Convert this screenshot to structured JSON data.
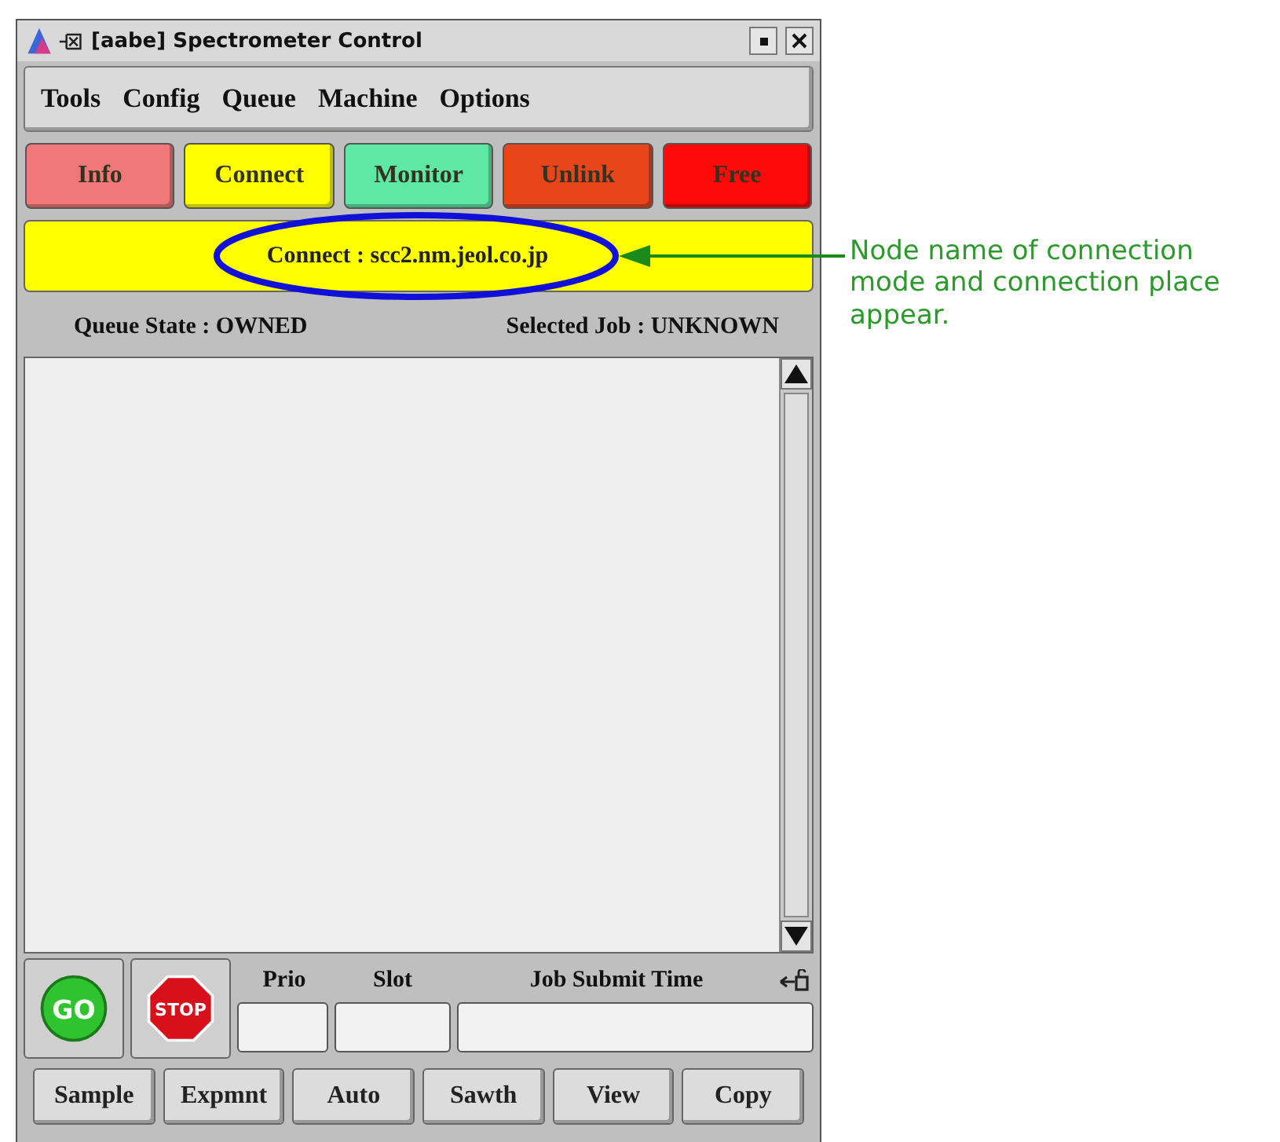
{
  "window": {
    "title": "[aabe] Spectrometer Control"
  },
  "menu": [
    "Tools",
    "Config",
    "Queue",
    "Machine",
    "Options"
  ],
  "mode_buttons": [
    {
      "label": "Info",
      "color": "#f07878"
    },
    {
      "label": "Connect",
      "color": "#ffff00"
    },
    {
      "label": "Monitor",
      "color": "#5ee8a4"
    },
    {
      "label": "Unlink",
      "color": "#e8461a"
    },
    {
      "label": "Free",
      "color": "#ff0a0a"
    }
  ],
  "connection": {
    "text": "Connect : scc2.nm.jeol.co.jp"
  },
  "status": {
    "queue_state": "Queue State : OWNED",
    "selected_job": "Selected Job : UNKNOWN"
  },
  "controls": {
    "go": "GO",
    "stop": "STOP",
    "fields": [
      {
        "label": "Prio"
      },
      {
        "label": "Slot"
      },
      {
        "label": "Job Submit Time"
      }
    ]
  },
  "bottom_buttons": [
    "Sample",
    "Expmnt",
    "Auto",
    "Sawth",
    "View",
    "Copy"
  ],
  "annotation": {
    "text": "Node name of connection mode and connection place appear."
  }
}
